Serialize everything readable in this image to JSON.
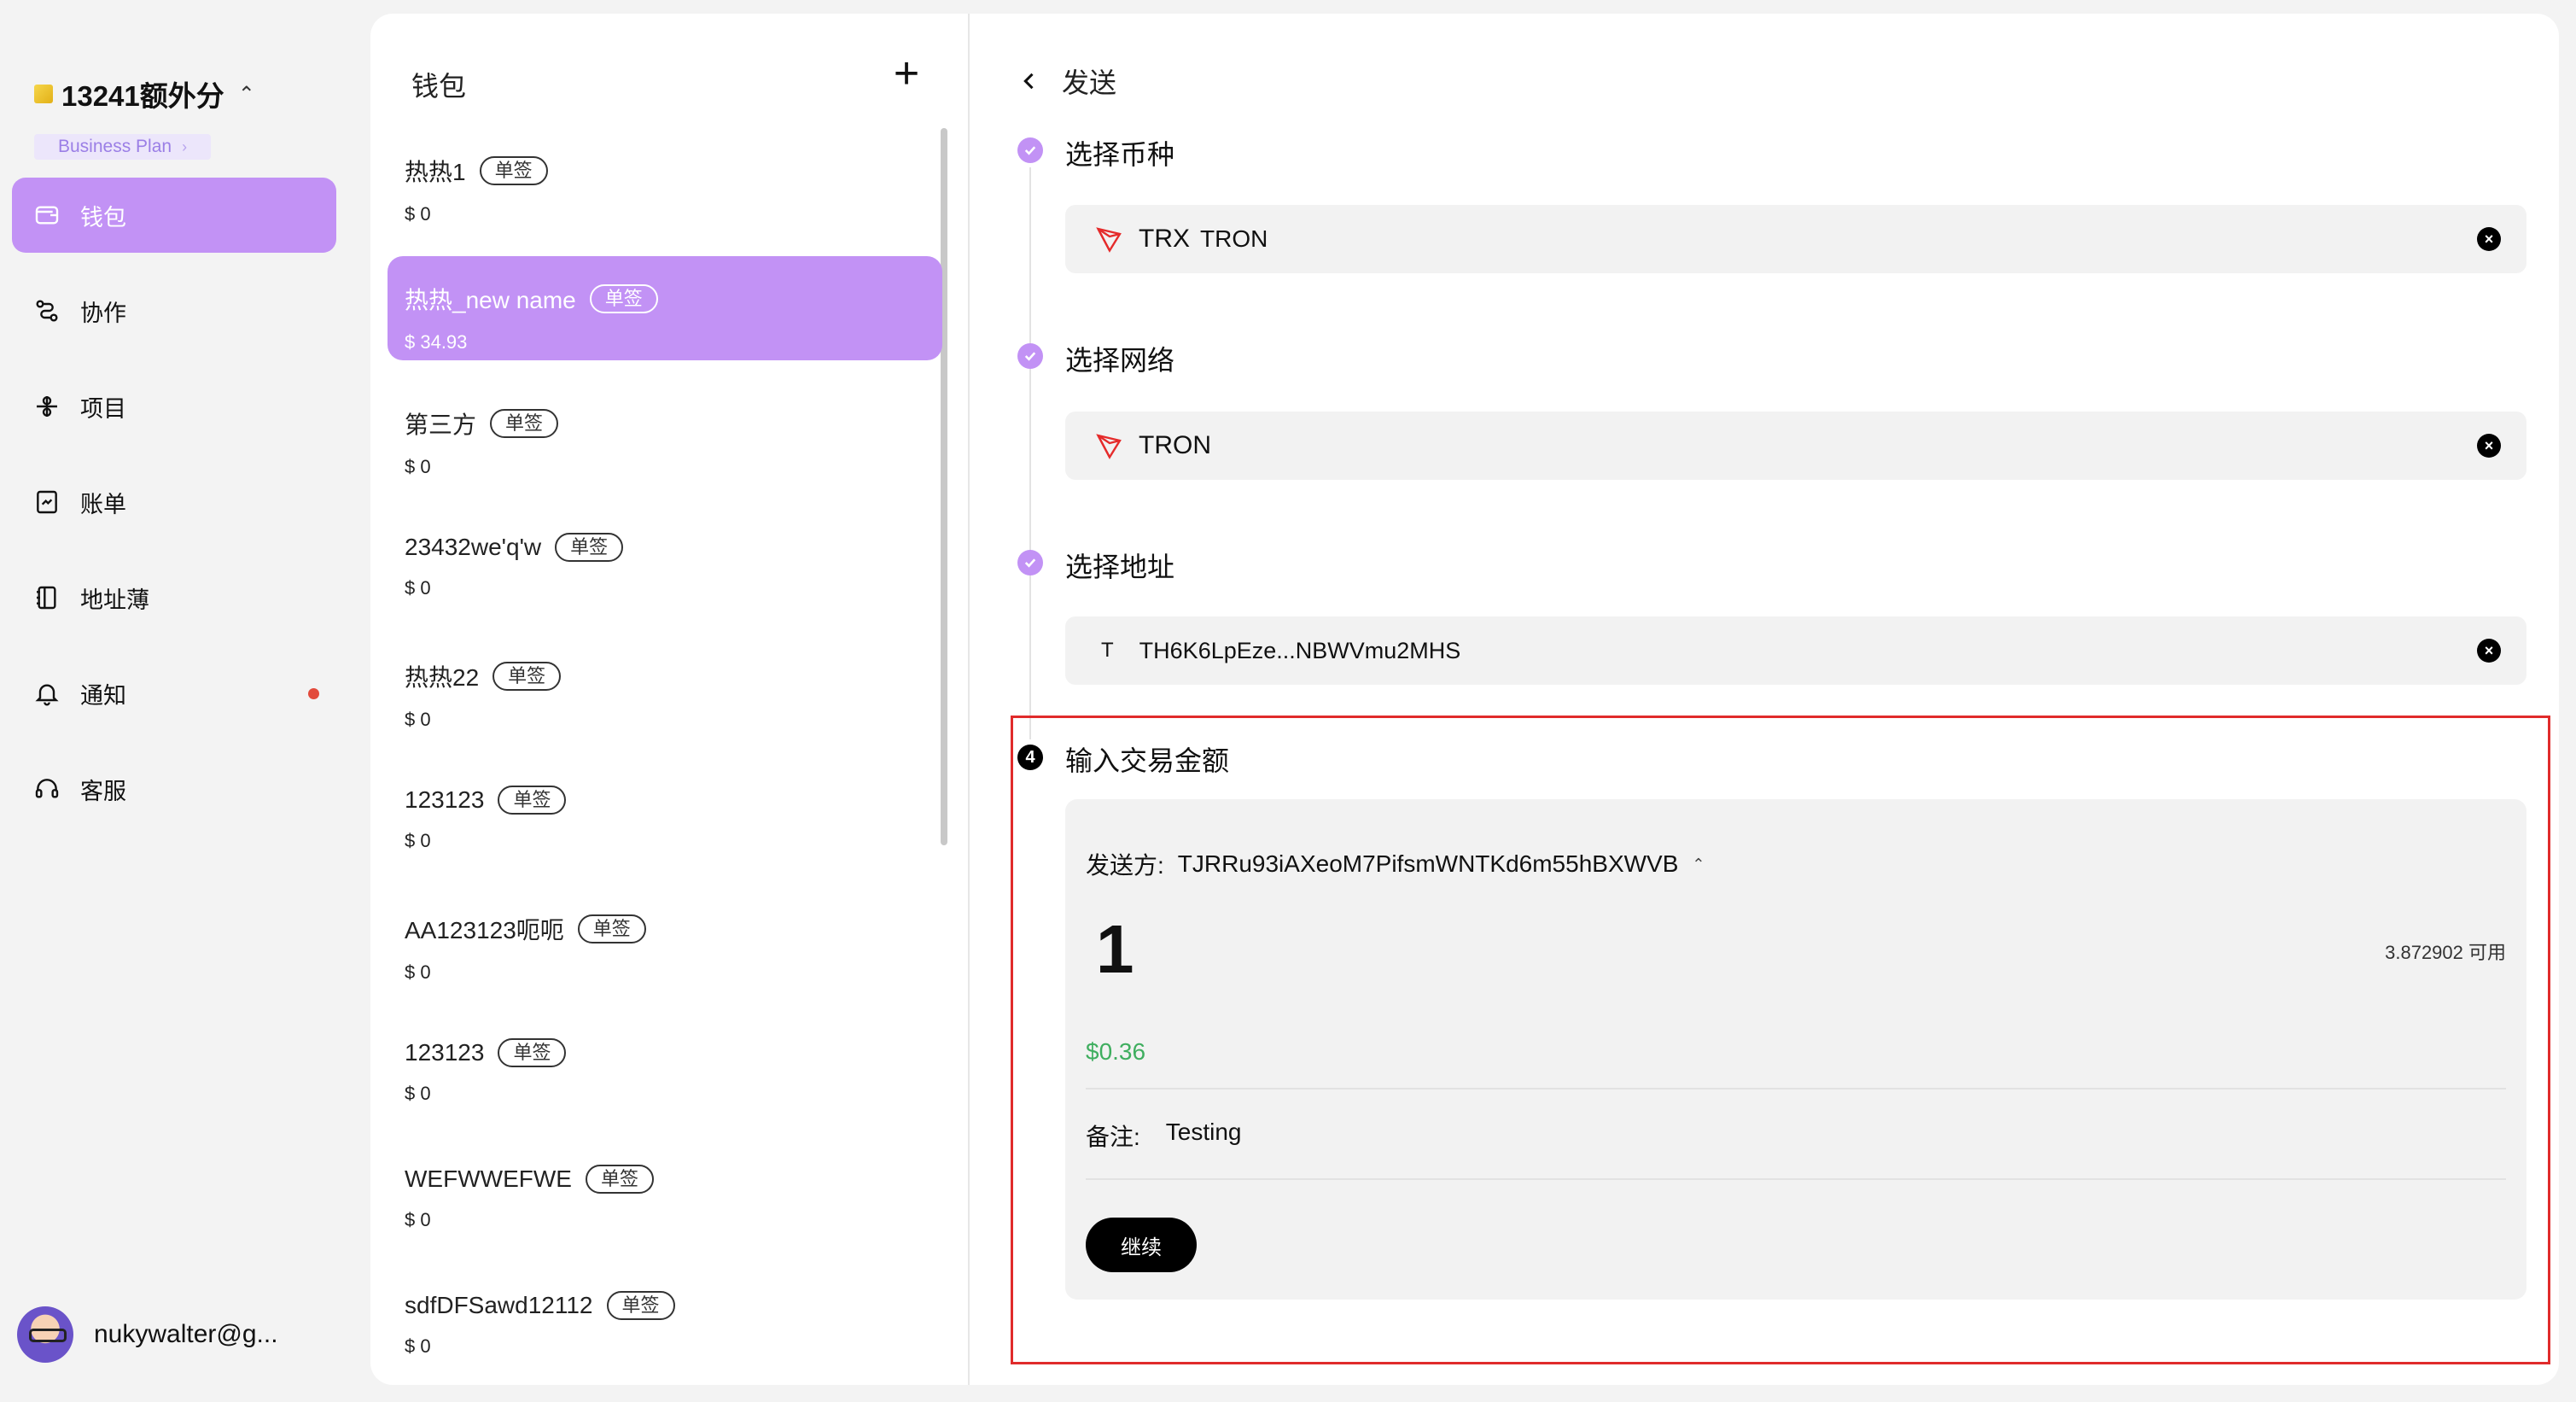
{
  "org": {
    "name": "13241额外分",
    "plan": "Business Plan"
  },
  "nav": {
    "items": [
      {
        "label": "钱包",
        "icon": "wallet-icon"
      },
      {
        "label": "协作",
        "icon": "collaboration-icon"
      },
      {
        "label": "项目",
        "icon": "project-icon"
      },
      {
        "label": "账单",
        "icon": "bill-icon"
      },
      {
        "label": "地址薄",
        "icon": "address-book-icon"
      },
      {
        "label": "通知",
        "icon": "bell-icon"
      },
      {
        "label": "客服",
        "icon": "headset-icon"
      }
    ]
  },
  "user": {
    "email": "nukywalter@g..."
  },
  "wallets": {
    "header": "钱包",
    "add_label": "+",
    "items": [
      {
        "name": "热热1",
        "badge": "单签",
        "balance": "$ 0"
      },
      {
        "name": "热热_new name",
        "badge": "单签",
        "balance": "$ 34.93"
      },
      {
        "name": "第三方",
        "badge": "单签",
        "balance": "$ 0"
      },
      {
        "name": "23432we'q'w",
        "badge": "单签",
        "balance": "$ 0"
      },
      {
        "name": "热热22",
        "badge": "单签",
        "balance": "$ 0"
      },
      {
        "name": "123123",
        "badge": "单签",
        "balance": "$ 0"
      },
      {
        "name": "AA123123呃呃",
        "badge": "单签",
        "balance": "$ 0"
      },
      {
        "name": "123123",
        "badge": "单签",
        "balance": "$ 0"
      },
      {
        "name": "WEFWWEFWE",
        "badge": "单签",
        "balance": "$ 0"
      },
      {
        "name": "sdfDFSawd12112",
        "badge": "单签",
        "balance": "$ 0"
      }
    ]
  },
  "send": {
    "title": "发送",
    "steps": {
      "coin": {
        "title": "选择币种",
        "symbol": "TRX",
        "name": "TRON"
      },
      "network": {
        "title": "选择网络",
        "name": "TRON"
      },
      "address": {
        "title": "选择地址",
        "prefix": "T",
        "value": "TH6K6LpEze...NBWVmu2MHS"
      },
      "amount": {
        "number": "4",
        "title": "输入交易金额",
        "from_label": "发送方:",
        "from_address": "TJRRu93iAXeoM7PifsmWNTKd6m55hBXWVB",
        "amount_value": "1",
        "available": "3.872902 可用",
        "usd_value": "$0.36",
        "memo_label": "备注:",
        "memo_value": "Testing",
        "continue_label": "继续"
      }
    }
  },
  "colors": {
    "accent": "#c292f5",
    "highlight": "#e02b2b",
    "usd_green": "#3fae5f"
  }
}
